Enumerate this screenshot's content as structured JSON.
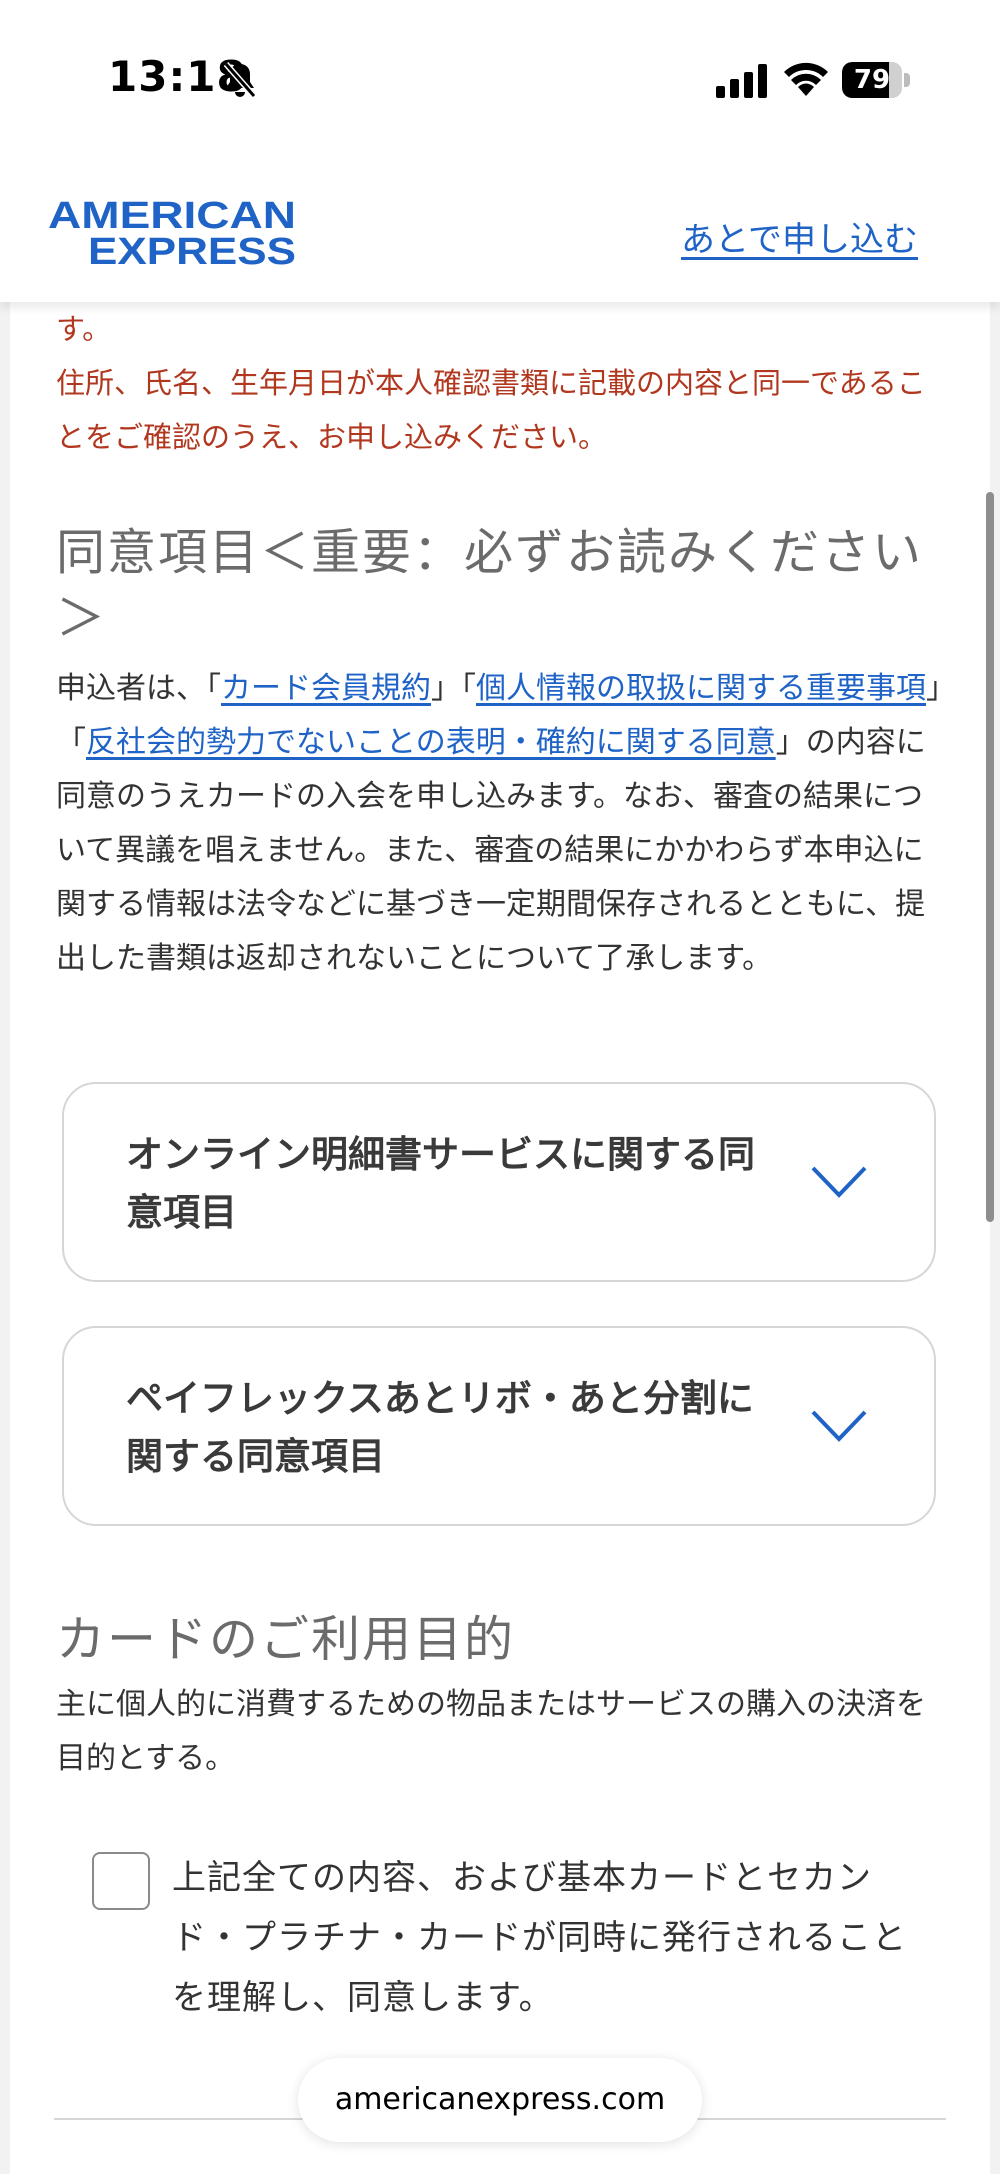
{
  "status_bar": {
    "time": "13:18",
    "battery": "79",
    "battery_level": 0.79
  },
  "header": {
    "logo_line1": "AMERICAN",
    "logo_line2": "EXPRESS",
    "apply_later": "あとで申し込む"
  },
  "notice": {
    "line0": "す。",
    "text": "住所、氏名、生年月日が本人確認書類に記載の内容と同一であることをご確認のうえ、お申し込みください。"
  },
  "agreement": {
    "title": "同意項目＜重要：必ずお読みください＞",
    "intro": "申込者は、「",
    "link1": "カード会員規約",
    "sep1": "」「",
    "link2": "個人情報の取扱に関する重要事項",
    "sep2": "」「",
    "link3": "反社会的勢力でないことの表明・確約に関する同意",
    "rest": "」の内容に同意のうえカードの入会を申し込みます。なお、審査の結果について異議を唱えません。また、審査の結果にかかわらず本申込に関する情報は法令などに基づき一定期間保存されるとともに、提出した書類は返却されないことについて了承します。"
  },
  "accordions": [
    {
      "label": "オンライン明細書サービスに関する同意項目"
    },
    {
      "label": "ペイフレックスあとリボ・あと分割に関する同意項目"
    }
  ],
  "purpose": {
    "title": "カードのご利用目的",
    "text": "主に個人的に消費するための物品またはサービスの購入の決済を目的とする。"
  },
  "consent": {
    "checked": false,
    "label": "上記全ての内容、および基本カードとセカンド・プラチナ・カードが同時に発行されることを理解し、同意します。"
  },
  "browser": {
    "url": "americanexpress.com"
  },
  "colors": {
    "brand_blue": "#1f63c7",
    "notice_red": "#b1381f"
  }
}
